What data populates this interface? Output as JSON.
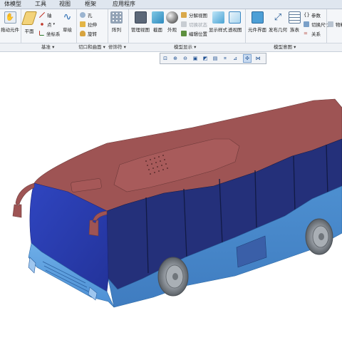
{
  "tabs": [
    "体模型",
    "工具",
    "视图",
    "框架",
    "应用程序"
  ],
  "ribbon": {
    "drag_components": "拖动元件",
    "plane": "平面",
    "axis": "轴",
    "point": "点",
    "coordinate_system": "坐标系",
    "sketch": "草绘",
    "hole": "孔",
    "extrude": "拉伸",
    "revolve": "旋转",
    "pattern": "阵列",
    "manage_views": "管理视图",
    "section": "截面",
    "appearance": "外观",
    "exploded_view": "分解视图",
    "toggle_status": "切换状态",
    "edit_position": "编辑位置",
    "display_style": "显示样式",
    "perspective_view": "透视图",
    "component_interface": "元件界面",
    "publish_geometry": "发布几何",
    "table": "族表",
    "parameters": "参数",
    "switch_dimensions": "切换尺寸",
    "relations": "关系",
    "bill_of_materials": "物料"
  },
  "groups": {
    "datum": "基准",
    "cut_and_surface": "切口和曲面",
    "modifier": "修饰符",
    "model_display": "模型显示",
    "model_intent": "模型意图"
  },
  "view_toolbar": {
    "icons": [
      "refit-icon",
      "zoom-in-icon",
      "zoom-out-icon",
      "repaint-icon",
      "display-style-icon",
      "saved-views-icon",
      "datum-display-icon",
      "annotation-display-icon",
      "spin-center-icon",
      "assembly-display-icon"
    ]
  },
  "colors": {
    "roof": "#9e5454",
    "window_band": "#24307a",
    "lower_body": "#4d8fd0",
    "front_face": "#2f45c0",
    "wheel": "#9aa0a6",
    "ribbon_bg": "#f4f6f9",
    "tab_bg": "#dfe6ef"
  }
}
